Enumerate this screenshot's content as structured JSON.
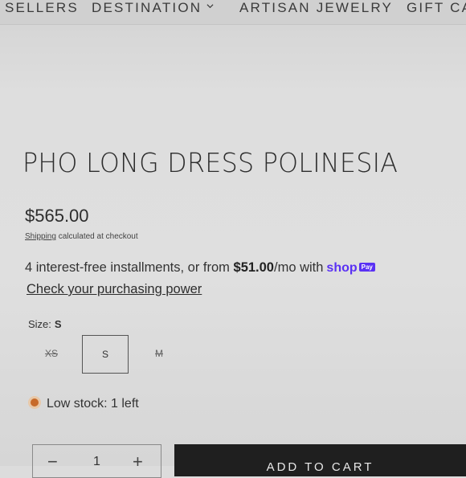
{
  "nav": {
    "items": [
      {
        "label": "SELLERS"
      },
      {
        "label": "DESTINATION"
      },
      {
        "label": "ARTISAN JEWELRY"
      },
      {
        "label": "GIFT CA"
      }
    ]
  },
  "product": {
    "title": "PHO LONG DRESS POLINESIA",
    "price": "$565.00",
    "shipping_link": "Shipping",
    "shipping_rest": " calculated at checkout",
    "installments_prefix": "4 interest-free installments, or from ",
    "installments_amount": "$51.00",
    "installments_suffix": "/mo with",
    "shop_logo": "shop",
    "pay_badge": "Pay",
    "check_power": "Check your purchasing power"
  },
  "size": {
    "label": "Size:",
    "selected": "S",
    "options": [
      {
        "label": "XS",
        "state": "unavailable"
      },
      {
        "label": "S",
        "state": "selected"
      },
      {
        "label": "M",
        "state": "unavailable"
      }
    ]
  },
  "stock": {
    "text": "Low stock: 1 left"
  },
  "quantity": {
    "minus": "−",
    "value": "1",
    "plus": "+"
  },
  "cart": {
    "add_label": "ADD TO CART"
  }
}
